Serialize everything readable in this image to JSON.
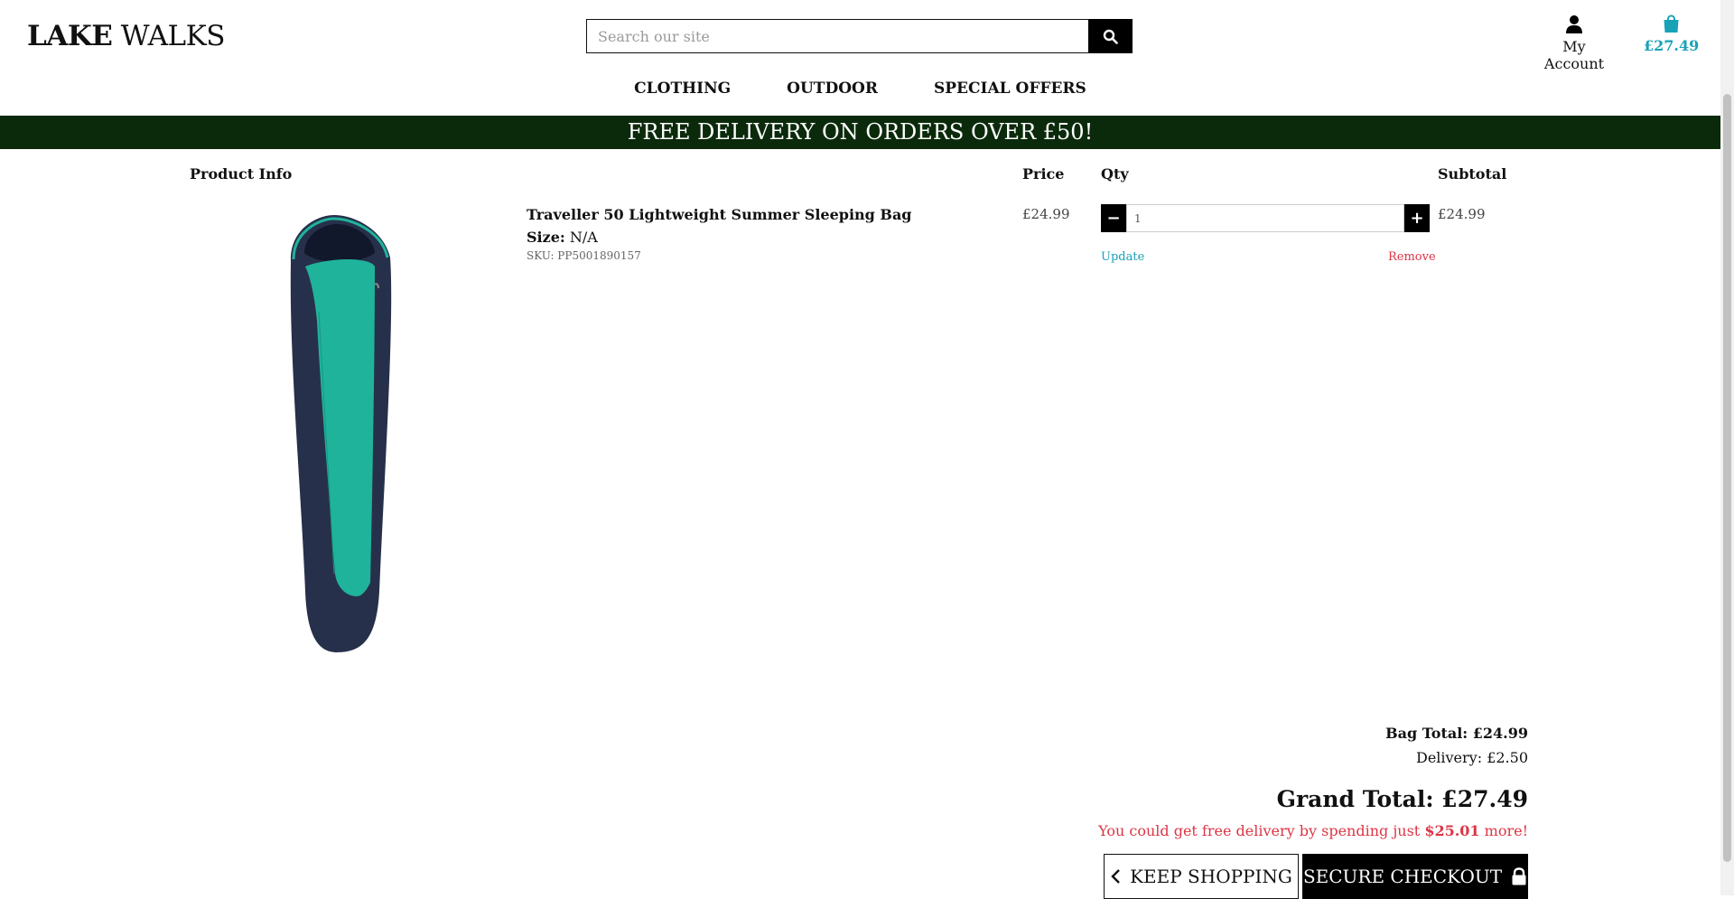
{
  "header": {
    "logo_part1": "LAKE",
    "logo_part2": "WALKS",
    "search_placeholder": "Search our site",
    "search_icon": "search-icon",
    "account_label": "My Account",
    "account_icon": "user-icon",
    "bag_icon": "shopping-bag-icon",
    "bag_total": "£27.49"
  },
  "nav": {
    "items": [
      "CLOTHING",
      "OUTDOOR",
      "SPECIAL OFFERS"
    ]
  },
  "banner": "FREE DELIVERY ON ORDERS OVER £50!",
  "table": {
    "headers": {
      "product_info": "Product Info",
      "price": "Price",
      "qty": "Qty",
      "subtotal": "Subtotal"
    },
    "items": [
      {
        "name": "Traveller 50 Lightweight Summer Sleeping Bag",
        "size_label": "Size:",
        "size_value": "N/A",
        "sku": "SKU: PP5001890157",
        "price": "£24.99",
        "qty": "1",
        "subtotal": "£24.99",
        "update_label": "Update",
        "remove_label": "Remove"
      }
    ]
  },
  "totals": {
    "bag_total": "Bag Total: £24.99",
    "delivery": "Delivery: £2.50",
    "grand_total": "Grand Total: £27.49",
    "free_prefix": "You could get free delivery by spending just ",
    "free_amount": "$25.01",
    "free_suffix": " more!"
  },
  "buttons": {
    "keep_shopping": "KEEP SHOPPING",
    "secure_checkout": "SECURE CHECKOUT",
    "keep_icon": "chevron-left-icon",
    "checkout_icon": "lock-icon"
  },
  "colors": {
    "accent": "#17a2b8",
    "danger": "#dc3545",
    "banner_bg": "#0b2a0b"
  }
}
